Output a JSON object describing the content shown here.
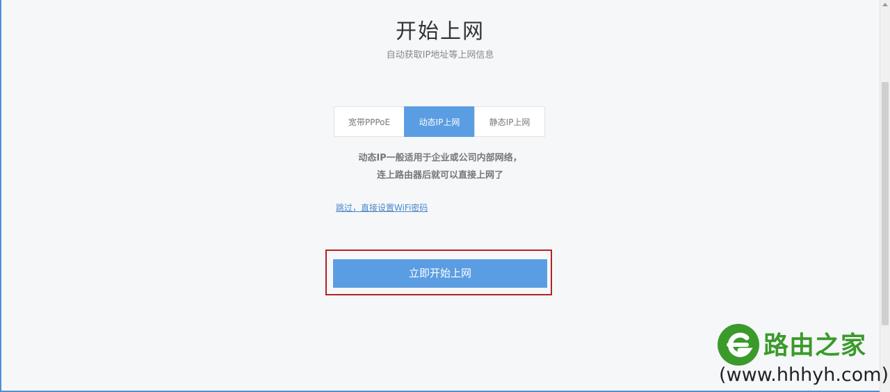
{
  "page": {
    "title": "开始上网",
    "subtitle": "自动获取IP地址等上网信息"
  },
  "tabs": [
    {
      "label": "宽带PPPoE",
      "active": false
    },
    {
      "label": "动态IP上网",
      "active": true
    },
    {
      "label": "静态IP上网",
      "active": false
    }
  ],
  "description": {
    "line1": "动态IP一般适用于企业或公司内部网络，",
    "line2": "连上路由器后就可以直接上网了"
  },
  "skip_link": "跳过，直接设置WiFi密码",
  "start_button": "立即开始上网",
  "watermark": {
    "name": "路由之家",
    "url": "(www.hhhyh.com)"
  },
  "colors": {
    "accent": "#5b9de2",
    "highlight_border": "#b22222",
    "watermark_green": "#3a9a2a",
    "watermark_red": "#d9342b"
  }
}
